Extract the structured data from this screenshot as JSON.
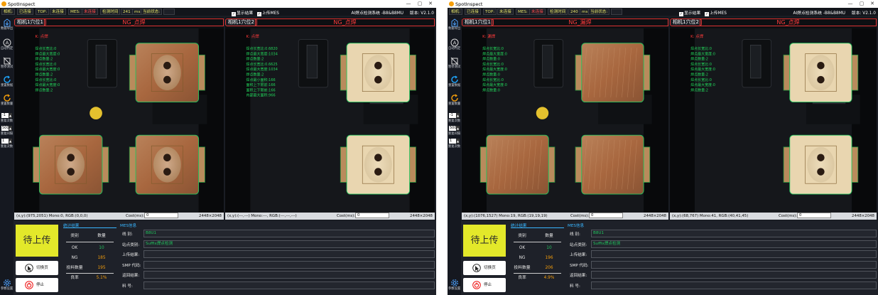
{
  "windows": [
    {
      "app_title": "SpotInspect",
      "controls": {
        "minimize": "—",
        "maximize": "▢",
        "close": "✕"
      },
      "status": {
        "camera": "相机:",
        "connected": "已连接",
        "top": "TOP:",
        "disconnected": "未连接",
        "mes": "MES:",
        "mes_state": "未连接",
        "detect_time_label": "检测时间",
        "detect_time_value": "241",
        "detect_time_unit": "ms",
        "current_state_label": "当前状态:",
        "current_state_value": ""
      },
      "checkboxes": {
        "show_result": "显示结果",
        "upload_mes": "上传MES"
      },
      "system_name": "AI焊点检测系统 -B8&B8MU",
      "version_label": "版本: V2.1.0",
      "toolbar": {
        "data_export": "数据导出",
        "auto_judge": "自动判定",
        "stop_test": "暂停测试",
        "reset_count": "重置数据",
        "reset_count2": "重置数量",
        "spin1": "-1",
        "spin1_label": "重复次数",
        "spin2": "500",
        "spin2_label": "重复间隔",
        "spin3": "1",
        "spin3_label": "重复次数",
        "settings": "参数设置"
      },
      "panes": [
        {
          "camera_label": "相机1穴位1",
          "result_title": "NG_点焊",
          "overlay_small": "K: 点焊",
          "overlay_lines": [
            "焊点长宽比:0",
            "焊点最大宽度:0",
            "焊点数量:2",
            "焊点长宽比:0",
            "焊点最大宽度:0",
            "焊点数量:2",
            "焊点长宽比:0",
            "焊点最大宽度:0",
            "焊点数量:2"
          ],
          "coord_info": "(x,y):(975,2051) Mono:0, RGB:(0,0,0)",
          "cost_label": "Cost(ms):",
          "cost_value": "0",
          "resolution": "2448×2048"
        },
        {
          "camera_label": "相机1穴位2",
          "result_title": "NG_点焊",
          "overlay_small": "K: 点焊",
          "overlay_lines": [
            "焊点长宽比:0.6820",
            "焊点最大宽度:1034",
            "焊点数量:2",
            "焊点长宽比:0.6625",
            "焊点最大宽度:1034",
            "焊点数量:2",
            "焊点最小面积:166",
            "面积上下限前:166",
            "面积上下限前:166",
            "内部最大面积:966"
          ],
          "coord_info": "(x,y):(---,---) Mono:---, RGB:(---,---,---)",
          "cost_label": "Cost(ms):",
          "cost_value": "0",
          "resolution": "2448×2048"
        }
      ],
      "bottom": {
        "upload_label": "待上传",
        "change_btn": "切换页",
        "stop_btn": "停止",
        "stats_title": "统计结果",
        "stats_headers": [
          "类别",
          "数量"
        ],
        "stats_rows": [
          {
            "k": "OK",
            "v": "10",
            "color": "#22c55e"
          },
          {
            "k": "NG",
            "v": "185",
            "color": "#f59e0b"
          },
          {
            "k": "投料数量",
            "v": "195",
            "color": "#f59e0b"
          },
          {
            "k": "良率",
            "v": "5.1%",
            "color": "#f59e0b"
          }
        ],
        "mes_title": "MES信息",
        "mes_rows": [
          {
            "k": "线    别:",
            "v": "B8U1"
          },
          {
            "k": "站点类别:",
            "v": "Suffix焊点检测"
          },
          {
            "k": "上传结果:",
            "v": ""
          },
          {
            "k": "SMP 代码:",
            "v": ""
          },
          {
            "k": "返回结果:",
            "v": ""
          },
          {
            "k": "料    号:",
            "v": ""
          }
        ]
      }
    },
    {
      "app_title": "SpotInspect",
      "controls": {
        "minimize": "—",
        "maximize": "▢",
        "close": "✕"
      },
      "status": {
        "camera": "相机:",
        "connected": "已连接",
        "top": "TOP:",
        "disconnected": "未连接",
        "mes": "MES:",
        "mes_state": "未连接",
        "detect_time_label": "检测时间",
        "detect_time_value": "240",
        "detect_time_unit": "ms",
        "current_state_label": "当前状态:",
        "current_state_value": ""
      },
      "checkboxes": {
        "show_result": "显示结果",
        "upload_mes": "上传MES"
      },
      "system_name": "AI焊点检测系统 -B8&B8MU",
      "version_label": "版本: V2.1.0",
      "toolbar": {
        "data_export": "数据导出",
        "auto_judge": "自动判定",
        "stop_test": "暂停测试",
        "reset_count": "重置数据",
        "reset_count2": "重置数量",
        "spin1": "-1",
        "spin1_label": "重复次数",
        "spin2": "500",
        "spin2_label": "重复间隔",
        "spin3": "1",
        "spin3_label": "重复次数",
        "settings": "参数设置"
      },
      "panes": [
        {
          "camera_label": "相机1穴位1",
          "result_title": "NG_漏焊",
          "overlay_small": "K: 漏焊",
          "overlay_lines": [
            "焊点长宽比:0",
            "焊点最大宽度:0",
            "焊点数量:0",
            "焊点长宽比:0",
            "焊点最大宽度:0",
            "焊点数量:0",
            "焊点长宽比:0",
            "焊点最大宽度:0",
            "焊点数量:0"
          ],
          "coord_info": "(x,y):(1076,1527) Mono:19, RGB:(19,19,19)",
          "cost_label": "Cost(ms):",
          "cost_value": "0",
          "resolution": "2448×2048"
        },
        {
          "camera_label": "相机1穴位2",
          "result_title": "NG_点焊",
          "overlay_small": "K: 点焊",
          "overlay_lines": [
            "焊点长宽比:0",
            "焊点最大宽度:0",
            "焊点数量:2",
            "焊点长宽比:0",
            "焊点最大宽度:0",
            "焊点数量:2",
            "焊点长宽比:0",
            "焊点最大宽度:0",
            "焊点数量:2"
          ],
          "coord_info": "(x,y):(68,767) Mono:41, RGB:(40,41,45)",
          "cost_label": "Cost(ms):",
          "cost_value": "0",
          "resolution": "2448×2048"
        }
      ],
      "bottom": {
        "upload_label": "待上传",
        "change_btn": "切换页",
        "stop_btn": "停止",
        "stats_title": "统计结果",
        "stats_headers": [
          "类别",
          "数量"
        ],
        "stats_rows": [
          {
            "k": "OK",
            "v": "10",
            "color": "#22c55e"
          },
          {
            "k": "NG",
            "v": "196",
            "color": "#f59e0b"
          },
          {
            "k": "投料数量",
            "v": "206",
            "color": "#f59e0b"
          },
          {
            "k": "良率",
            "v": "4.9%",
            "color": "#f59e0b"
          }
        ],
        "mes_title": "MES信息",
        "mes_rows": [
          {
            "k": "线    别:",
            "v": "B8U1"
          },
          {
            "k": "站点类别:",
            "v": "Suffix焊点检测"
          },
          {
            "k": "上传结果:",
            "v": ""
          },
          {
            "k": "SMP 代码:",
            "v": ""
          },
          {
            "k": "返回结果:",
            "v": ""
          },
          {
            "k": "料    号:",
            "v": ""
          }
        ]
      }
    }
  ]
}
